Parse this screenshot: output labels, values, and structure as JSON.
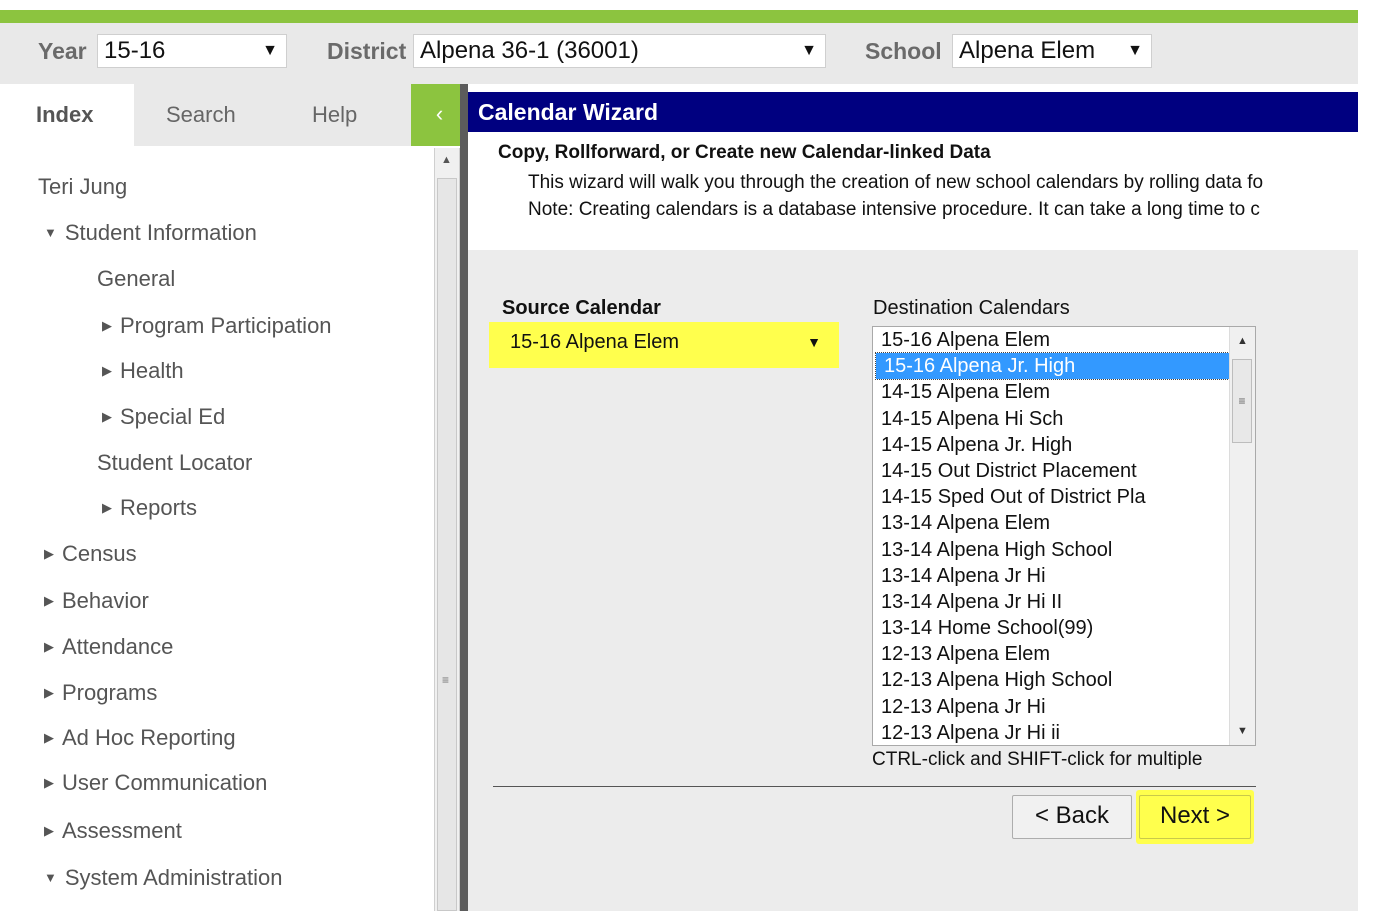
{
  "topbar": {
    "year_label": "Year",
    "year_value": "15-16",
    "district_label": "District",
    "district_value": "Alpena 36-1 (36001)",
    "school_label": "School",
    "school_value": "Alpena Elem"
  },
  "tabs": [
    "Index",
    "Search",
    "Help"
  ],
  "collapse_icon": "chevron-left-icon",
  "tree": {
    "user": "Teri Jung",
    "items": [
      {
        "label": "Student Information",
        "expanded": true
      },
      {
        "label": "General"
      },
      {
        "label": "Program Participation"
      },
      {
        "label": "Health"
      },
      {
        "label": "Special Ed"
      },
      {
        "label": "Student Locator"
      },
      {
        "label": "Reports"
      },
      {
        "label": "Census"
      },
      {
        "label": "Behavior"
      },
      {
        "label": "Attendance"
      },
      {
        "label": "Programs"
      },
      {
        "label": "Ad Hoc Reporting"
      },
      {
        "label": "User Communication"
      },
      {
        "label": "Assessment"
      },
      {
        "label": "System Administration",
        "expanded": true
      }
    ]
  },
  "wizard": {
    "title": "Calendar Wizard",
    "heading": "Copy, Rollforward, or Create new Calendar-linked Data",
    "line1": "This wizard will walk you through the creation of new school calendars by rolling data fo",
    "line2": "Note: Creating calendars is a database intensive procedure. It can take a long time to c",
    "source_label": "Source Calendar",
    "source_value": "15-16 Alpena Elem",
    "dest_label": "Destination Calendars",
    "dest_options": [
      "15-16 Alpena Elem",
      "15-16 Alpena Jr. High",
      "14-15 Alpena Elem",
      "14-15 Alpena Hi Sch",
      "14-15 Alpena Jr. High",
      "14-15 Out District Placement",
      "14-15 Sped Out of District Pla",
      "13-14 Alpena Elem",
      "13-14 Alpena High School",
      "13-14 Alpena Jr Hi",
      "13-14 Alpena Jr Hi II",
      "13-14 Home School(99)",
      "12-13 Alpena Elem",
      "12-13 Alpena High School",
      "12-13 Alpena Jr Hi",
      "12-13 Alpena Jr Hi ii"
    ],
    "dest_selected": "15-16 Alpena Jr. High",
    "hint": "CTRL-click and SHIFT-click for multiple",
    "back_label": "< Back",
    "next_label": "Next >"
  },
  "colors": {
    "brand_green": "#8cc43f",
    "title_bar": "#000080",
    "highlight": "#ffff4d",
    "list_selected": "#3399ff"
  }
}
